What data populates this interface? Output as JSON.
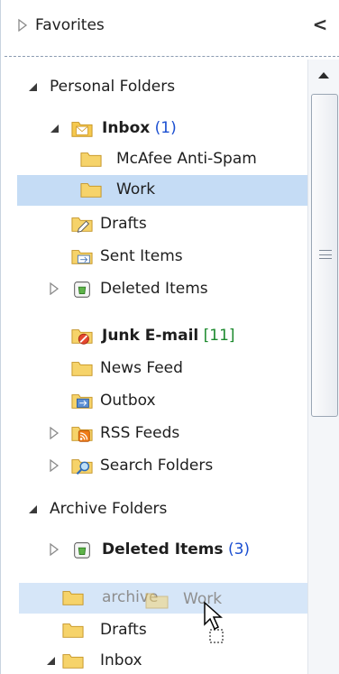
{
  "favorites": {
    "label": "Favorites",
    "collapse_glyph": "<"
  },
  "tree": {
    "personal_folders": "Personal Folders",
    "inbox": {
      "label": "Inbox",
      "count": "(1)"
    },
    "mcafee": "McAfee Anti-Spam",
    "work": "Work",
    "drafts": "Drafts",
    "sent": "Sent Items",
    "deleted": "Deleted Items",
    "junk": {
      "label": "Junk E-mail",
      "count": "[11]"
    },
    "news": "News Feed",
    "outbox": "Outbox",
    "rss": "RSS Feeds",
    "search": "Search Folders",
    "archive_folders": "Archive Folders",
    "archive_deleted": {
      "label": "Deleted Items",
      "count": "(3)"
    },
    "archive": "archive",
    "archive_drafts": "Drafts",
    "archive_inbox": "Inbox"
  },
  "drag": {
    "label": "Work"
  },
  "colors": {
    "selection": "#c5dcf5",
    "count_blue": "#1b4fd1",
    "count_green": "#1d8a2e"
  },
  "icons": [
    "triangle-right-icon",
    "triangle-down-icon",
    "folder-icon",
    "mail-folder-icon",
    "drafts-icon",
    "sent-icon",
    "deleted-icon",
    "junk-icon",
    "outbox-icon",
    "rss-icon",
    "search-folder-icon",
    "cursor-icon"
  ]
}
